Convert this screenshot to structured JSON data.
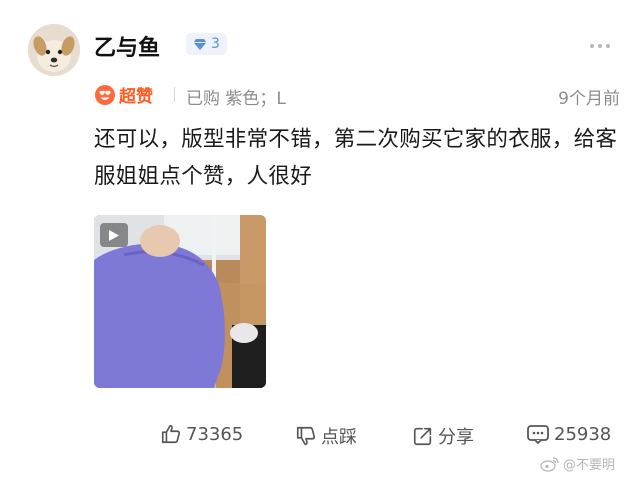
{
  "user": {
    "name": "乙与鱼",
    "level": "3",
    "avatar_icon": "dog-avatar"
  },
  "meta": {
    "rating_label": "超赞",
    "purchase_info": "已购 紫色；L",
    "time_ago": "9个月前"
  },
  "review": {
    "text": "还可以，版型非常不错，第二次购买它家的衣服，给客服姐姐点个赞，人很好"
  },
  "media": {
    "type": "video",
    "icon": "play-icon"
  },
  "actions": {
    "like_count": "73365",
    "dislike_label": "点踩",
    "share_label": "分享",
    "comment_count": "25938"
  },
  "watermark": {
    "text": "@不要明"
  },
  "colors": {
    "accent_orange": "#ff5a1f",
    "level_blue": "#5b8fd6",
    "muted_text": "#8c8c8c"
  }
}
